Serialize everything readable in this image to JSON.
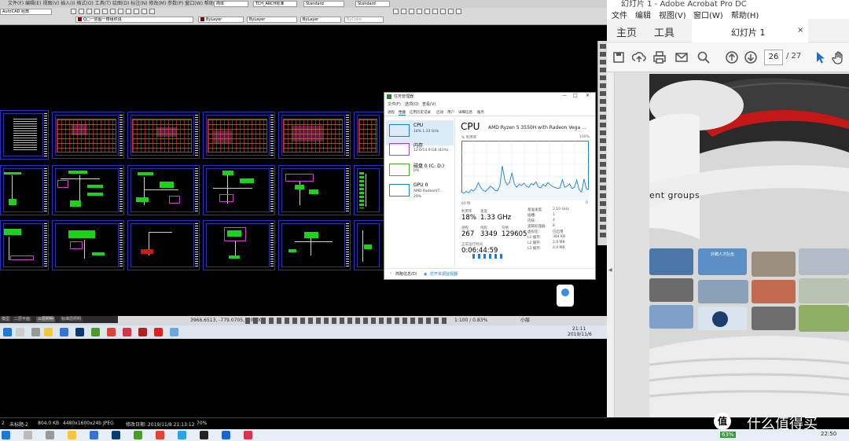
{
  "cad": {
    "app_label": "AutoCAD 经典",
    "toolbar_row1_combos": [
      "Standard",
      "Standard"
    ],
    "layer_combos": [
      "ByLayer",
      "ByLayer",
      "ByLayer",
      "ByColor"
    ],
    "layer_name": "TCH_ARCH标准",
    "view_label": "简体",
    "layer_state": "Q□一层图一楼组织说",
    "model_tabs": [
      "模型",
      "二层平面",
      "三层照明",
      "标准层照明"
    ],
    "coords": "3966.6513, -779.0705, 0.0000",
    "scale": "1:100 / 0.83%",
    "annotation_scale": "小层",
    "tray_time": "21:11",
    "tray_date": "2019/11/6"
  },
  "taskmgr": {
    "title": "任务管理器",
    "menu": [
      "文件(F)",
      "选项(O)",
      "查看(V)"
    ],
    "tabs": [
      "进程",
      "性能",
      "应用历史记录",
      "启动",
      "用户",
      "详细信息",
      "服务"
    ],
    "sidebar": [
      {
        "name": "CPU",
        "sub": "18% 1.33 GHz",
        "color": "#1a7fd6"
      },
      {
        "name": "内存",
        "sub": "12.0/14.9 GB (81%)",
        "color": "#a83ec0"
      },
      {
        "name": "磁盘 0 (C: D:)",
        "sub": "0%",
        "color": "#4caf2a"
      },
      {
        "name": "GPU 0",
        "sub": "AMD Radeon(T...",
        "sub2": "29%",
        "color": "#1a7fd6"
      }
    ],
    "cpu_title": "CPU",
    "cpu_model": "AMD Ryzen 5 3550H with Radeon Vega ...",
    "graph_label": "% 利用率",
    "graph_max": "100%",
    "graph_xlabel": "60 秒",
    "graph_xmin": "0",
    "utilization_label": "利用率",
    "utilization": "18%",
    "speed_label": "速度",
    "speed": "1.33 GHz",
    "processes_label": "进程",
    "processes": "267",
    "threads_label": "线程",
    "threads": "3349",
    "handles_label": "句柄",
    "handles": "129605",
    "uptime_label": "正常运行时间",
    "uptime": "0:06:44:59",
    "right_stats": [
      {
        "label": "基准速度:",
        "value": "2.10 GHz"
      },
      {
        "label": "插槽:",
        "value": "1"
      },
      {
        "label": "内核:",
        "value": "4"
      },
      {
        "label": "逻辑处理器:",
        "value": "8"
      },
      {
        "label": "虚拟化:",
        "value": "已启用"
      },
      {
        "label": "L1 缓存:",
        "value": "384 KB"
      },
      {
        "label": "L2 缓存:",
        "value": "2.0 MB"
      },
      {
        "label": "L3 缓存:",
        "value": "4.0 MB"
      }
    ],
    "less_details": "简略信息(D)",
    "open_monitor": "打开资源监视器",
    "cpu_history": [
      14,
      12,
      15,
      13,
      18,
      16,
      20,
      30,
      22,
      17,
      15,
      19,
      24,
      21,
      17,
      16,
      25,
      58,
      35,
      26,
      30,
      46,
      28,
      22,
      27,
      25,
      29,
      24,
      22,
      28,
      26,
      31,
      23,
      21,
      27,
      24,
      30,
      26,
      23,
      22,
      20,
      21,
      35,
      22,
      24,
      28,
      20,
      22,
      34,
      18,
      14,
      36,
      20,
      18
    ],
    "accent_color": "#1a7fd6"
  },
  "acrobat": {
    "title": "幻灯片 1 - Adobe Acrobat Pro DC",
    "menu": [
      "文件",
      "编辑",
      "视图(V)",
      "窗口(W)",
      "帮助(H)"
    ],
    "tab_home": "主页",
    "tab_tools": "工具",
    "tab_doc": "幻灯片 1",
    "page_current": "26",
    "page_total": "/ 27",
    "slide_text": "ent groups",
    "photo_caption": "外聘人才队伍"
  },
  "viewer_status": {
    "items": [
      "2",
      "未标题-2",
      "804.0 KB",
      "4480x1600x24b JPEG",
      "修改日期: 2019/11/8 21:13:12",
      "70%"
    ]
  },
  "windows_taskbar": {
    "battery": "63%",
    "time": "22:50",
    "watermark": "什么值得买"
  }
}
